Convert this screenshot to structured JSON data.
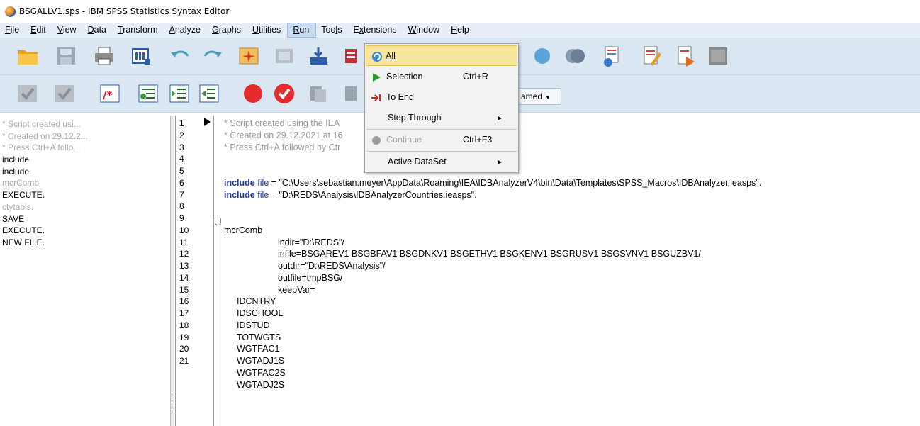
{
  "window": {
    "title": "BSGALLV1.sps - IBM SPSS Statistics Syntax Editor"
  },
  "menubar": [
    {
      "pre": "",
      "acc": "F",
      "post": "ile"
    },
    {
      "pre": "",
      "acc": "E",
      "post": "dit"
    },
    {
      "pre": "",
      "acc": "V",
      "post": "iew"
    },
    {
      "pre": "",
      "acc": "D",
      "post": "ata"
    },
    {
      "pre": "",
      "acc": "T",
      "post": "ransform"
    },
    {
      "pre": "",
      "acc": "A",
      "post": "nalyze"
    },
    {
      "pre": "",
      "acc": "G",
      "post": "raphs"
    },
    {
      "pre": "",
      "acc": "U",
      "post": "tilities"
    },
    {
      "pre": "",
      "acc": "R",
      "post": "un"
    },
    {
      "pre": "Too",
      "acc": "l",
      "post": "s"
    },
    {
      "pre": "E",
      "acc": "x",
      "post": "tensions"
    },
    {
      "pre": "",
      "acc": "W",
      "post": "indow"
    },
    {
      "pre": "",
      "acc": "H",
      "post": "elp"
    }
  ],
  "dataset_combo": {
    "value": "amed"
  },
  "run_menu": {
    "all": "All",
    "selection": "Selection",
    "selection_shortcut": "Ctrl+R",
    "to_end": "To End",
    "step_through": "Step Through",
    "continue": "Continue",
    "continue_shortcut": "Ctrl+F3",
    "active_dataset": "Active DataSet"
  },
  "outline": [
    {
      "text": "* Script created usi...",
      "dim": true
    },
    {
      "text": "* Created on 29.12.2...",
      "dim": true
    },
    {
      "text": "* Press Ctrl+A follo...",
      "dim": true
    },
    {
      "text": "include",
      "dim": false
    },
    {
      "text": "include",
      "dim": false
    },
    {
      "text": "mcrComb",
      "dim": true
    },
    {
      "text": "EXECUTE.",
      "dim": false
    },
    {
      "text": "ctytabls.",
      "dim": true
    },
    {
      "text": "SAVE",
      "dim": false
    },
    {
      "text": "EXECUTE.",
      "dim": false
    },
    {
      "text": "NEW FILE.",
      "dim": false
    }
  ],
  "line_numbers": [
    "1",
    "2",
    "3",
    "4",
    "5",
    "6",
    "7",
    "8",
    "9",
    "10",
    "11",
    "12",
    "13",
    "14",
    "15",
    "16",
    "17",
    "18",
    "19",
    "20",
    "21"
  ],
  "code": {
    "l1": "* Script created using the IEA",
    "l2": "* Created on 29.12.2021 at 16",
    "l3": "* Press Ctrl+A followed by Ctr",
    "l5_kw": "include",
    "l5_sub": "file",
    "l5_rest": " = \"C:\\Users\\sebastian.meyer\\AppData\\Roaming\\IEA\\IDBAnalyzerV4\\bin\\Data\\Templates\\SPSS_Macros\\IDBAnalyzer.ieasps\".",
    "l6_kw": "include",
    "l6_sub": "file",
    "l6_rest": " = \"D:\\REDS\\Analysis\\IDBAnalyzerCountries.ieasps\".",
    "l8": "mcrComb",
    "l9": "indir=\"D:\\REDS\"/",
    "l10": "infile=BSGAREV1 BSGBFAV1 BSGDNKV1 BSGETHV1 BSGKENV1 BSGRUSV1 BSGSVNV1 BSGUZBV1/",
    "l11": "outdir=\"D:\\REDS\\Analysis\"/",
    "l12": "outfile=tmpBSG/",
    "l13": "keepVar=",
    "l14": "IDCNTRY",
    "l15": "IDSCHOOL",
    "l16": "IDSTUD",
    "l17": "TOTWGTS",
    "l18": "WGTFAC1",
    "l19": "WGTADJ1S",
    "l20": "WGTFAC2S",
    "l21": "WGTADJ2S"
  }
}
